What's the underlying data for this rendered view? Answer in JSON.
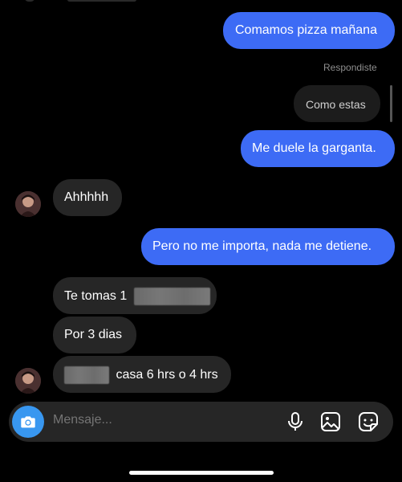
{
  "messages": [
    {
      "text": "Comamos pizza mañana"
    },
    {
      "text": "Me duele la garganta."
    },
    {
      "text": "Ahhhhh"
    },
    {
      "text": "Pero no me importa, nada me detiene."
    },
    {
      "text": "Te tomas 1"
    },
    {
      "text": "Por 3 dias"
    },
    {
      "text": "casa 6 hrs o 4 hrs"
    }
  ],
  "reply_label": "Respondiste",
  "reply_preview": "Como estas",
  "composer": {
    "placeholder": "Mensaje..."
  },
  "icons": {
    "camera": "camera-icon",
    "microphone": "microphone-icon",
    "gallery": "image-icon",
    "sticker": "sticker-icon"
  },
  "colors": {
    "outgoing": "#3d6bf5",
    "incoming": "#262626",
    "camera_button": "#3897f0"
  }
}
